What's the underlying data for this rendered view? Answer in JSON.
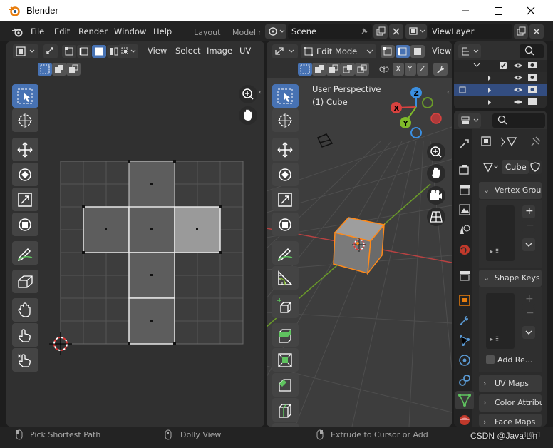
{
  "window": {
    "title": "Blender"
  },
  "topbar": {
    "menus": [
      "File",
      "Edit",
      "Render",
      "Window",
      "Help"
    ],
    "workspaces": [
      "Layout",
      "Modelin"
    ],
    "scene": "Scene",
    "view_layer": "ViewLayer"
  },
  "uv_editor": {
    "menus": [
      "View",
      "Select",
      "Image",
      "UV"
    ]
  },
  "viewport": {
    "mode": "Edit Mode",
    "view_menu": "View",
    "perspective": "User Perspective",
    "object_label": "(1) Cube",
    "axes": {
      "x": "X",
      "y": "Y",
      "z": "Z"
    }
  },
  "properties": {
    "object_name": "Cube",
    "panels": [
      "Vertex Grou",
      "Shape Keys",
      "Add Re...",
      "UV Maps",
      "Color Attribu",
      "Face Maps"
    ]
  },
  "statusbar": {
    "left": "Pick Shortest Path",
    "mid": "Dolly View",
    "right": "Extrude to Cursor or Add",
    "version": "3.0.1"
  },
  "watermark": "CSDN @Java Lin",
  "colors": {
    "accent": "#4772b3",
    "x_axis": "#d8423f",
    "y_axis": "#7fba2a",
    "z_axis": "#3b8fe0",
    "selection": "#ff8a1a"
  }
}
